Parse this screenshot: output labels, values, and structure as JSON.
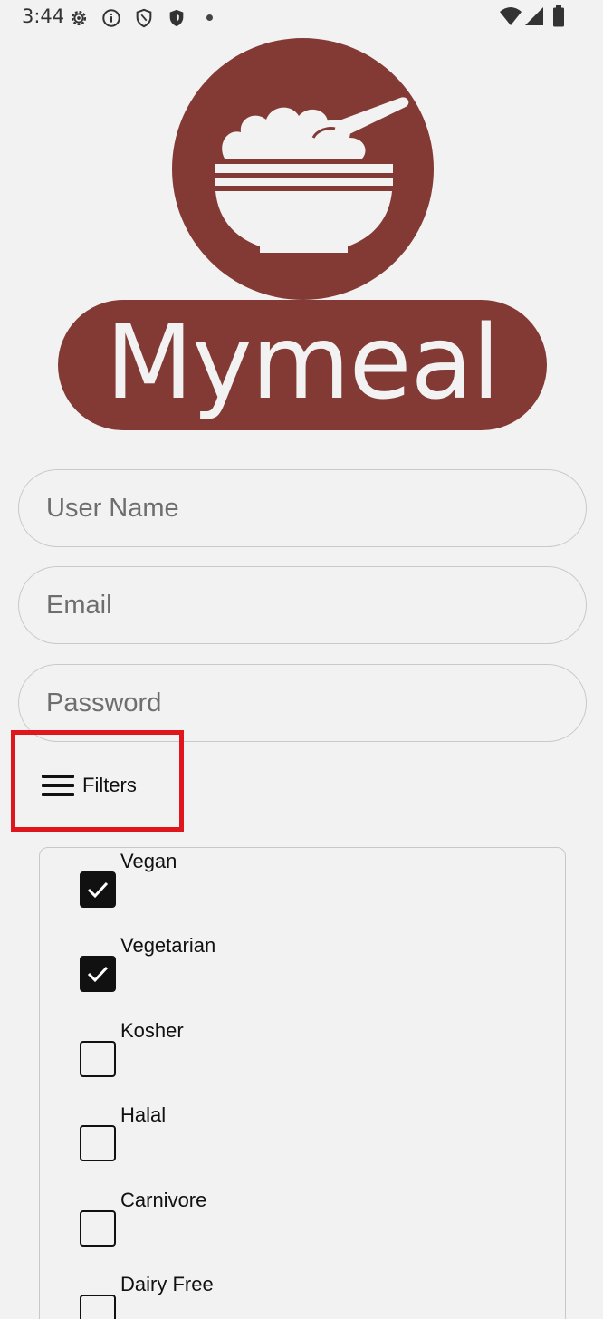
{
  "status_bar": {
    "time": "3:44",
    "icons": [
      "settings-icon",
      "info-icon",
      "shield-icon",
      "shield-filled-icon",
      "dot-icon",
      "wifi-icon",
      "signal-icon",
      "battery-icon"
    ]
  },
  "logo": {
    "wordmark": "Mymeal",
    "brand_color": "#833a34"
  },
  "form": {
    "username_placeholder": "User Name",
    "email_placeholder": "Email",
    "password_placeholder": "Password"
  },
  "filters": {
    "label": "Filters",
    "icon": "menu-icon",
    "highlight_color": "#e0161d",
    "options": [
      {
        "label": "Vegan",
        "checked": true
      },
      {
        "label": "Vegetarian",
        "checked": true
      },
      {
        "label": "Kosher",
        "checked": false
      },
      {
        "label": "Halal",
        "checked": false
      },
      {
        "label": "Carnivore",
        "checked": false
      },
      {
        "label": "Dairy Free",
        "checked": false
      }
    ]
  }
}
